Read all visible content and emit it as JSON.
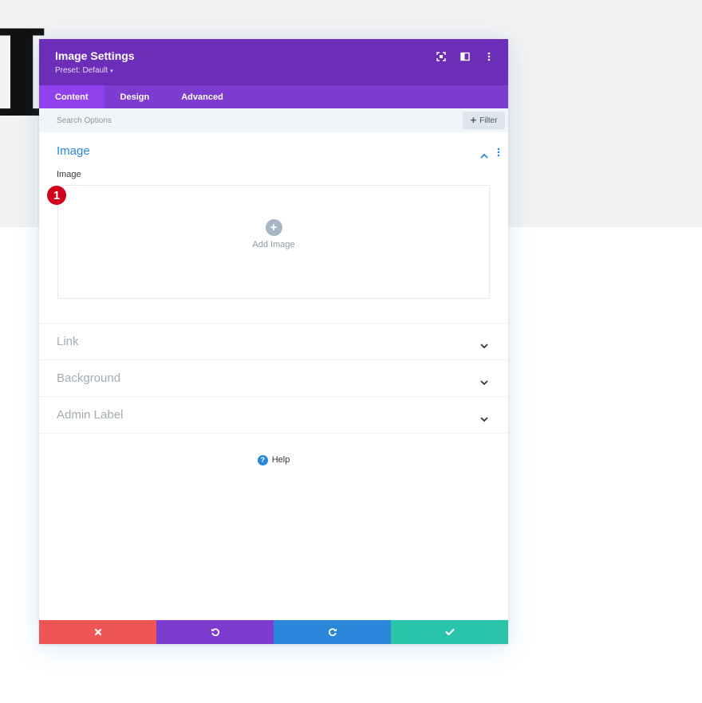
{
  "background": {
    "glyph": "I"
  },
  "modal": {
    "title": "Image Settings",
    "preset_label": "Preset: Default",
    "preset_caret": "▾",
    "header_icons": [
      "expand-icon",
      "sidebar-icon",
      "more-vertical-icon"
    ]
  },
  "tabs": [
    {
      "label": "Content",
      "active": true
    },
    {
      "label": "Design",
      "active": false
    },
    {
      "label": "Advanced",
      "active": false
    }
  ],
  "search": {
    "placeholder": "Search Options",
    "value": "",
    "filter_icon": "+",
    "filter_label": "Filter"
  },
  "sections": {
    "image": {
      "title": "Image",
      "field_label": "Image",
      "add_icon": "+",
      "add_label": "Add Image"
    },
    "link": {
      "title": "Link"
    },
    "background": {
      "title": "Background"
    },
    "admin_label": {
      "title": "Admin Label"
    }
  },
  "help": {
    "icon": "?",
    "label": "Help"
  },
  "footer_icons": [
    "close-icon",
    "undo-icon",
    "redo-icon",
    "check-icon"
  ],
  "badge": {
    "number": "1"
  },
  "colors": {
    "header": "#6c2eb9",
    "tabs": "#7e3bd0",
    "tab_active": "#8f42ec",
    "accent_blue": "#2b87da",
    "cancel": "#ef5555",
    "undo": "#7e3bd0",
    "redo": "#2b87da",
    "save": "#29c4a9",
    "badge": "#d0021b"
  }
}
